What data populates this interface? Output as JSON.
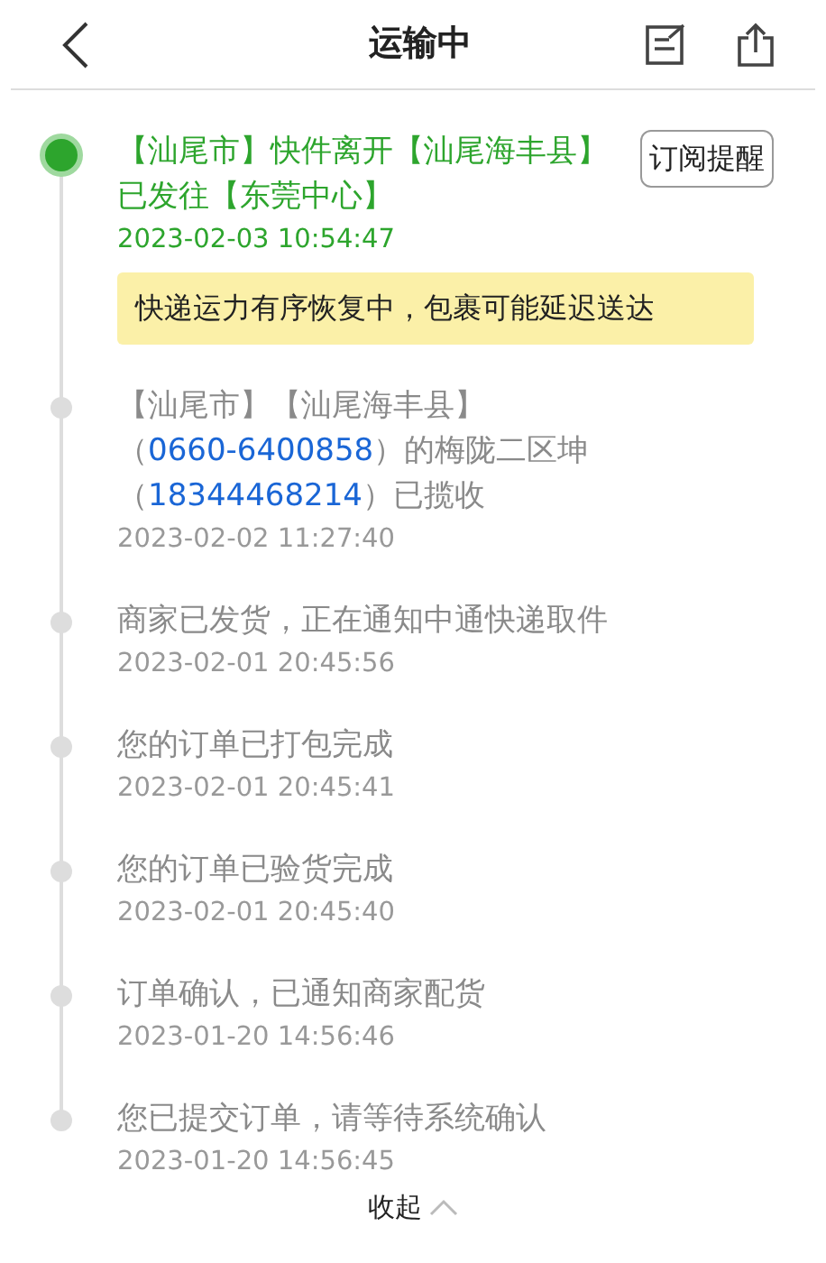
{
  "header": {
    "title": "运输中"
  },
  "subscribe_button": "订阅提醒",
  "notice": "快递运力有序恢复中，包裹可能延迟送达",
  "events": [
    {
      "current": true,
      "parts": [
        {
          "kind": "text",
          "text": "【汕尾市】快件离开【汕尾海丰县】已发往【东莞中心】"
        }
      ],
      "time": "2023-02-03 10:54:47"
    },
    {
      "current": false,
      "parts": [
        {
          "kind": "text",
          "text": "【汕尾市】【汕尾海丰县】（"
        },
        {
          "kind": "phone",
          "text": "0660-6400858"
        },
        {
          "kind": "text",
          "text": "）的梅陇二区坤（"
        },
        {
          "kind": "phone",
          "text": "18344468214"
        },
        {
          "kind": "text",
          "text": "）已揽收"
        }
      ],
      "time": "2023-02-02 11:27:40"
    },
    {
      "current": false,
      "parts": [
        {
          "kind": "text",
          "text": "商家已发货，正在通知中通快递取件"
        }
      ],
      "time": "2023-02-01 20:45:56"
    },
    {
      "current": false,
      "parts": [
        {
          "kind": "text",
          "text": "您的订单已打包完成"
        }
      ],
      "time": "2023-02-01 20:45:41"
    },
    {
      "current": false,
      "parts": [
        {
          "kind": "text",
          "text": "您的订单已验货完成"
        }
      ],
      "time": "2023-02-01 20:45:40"
    },
    {
      "current": false,
      "parts": [
        {
          "kind": "text",
          "text": "订单确认，已通知商家配货"
        }
      ],
      "time": "2023-01-20 14:56:46"
    },
    {
      "current": false,
      "parts": [
        {
          "kind": "text",
          "text": "您已提交订单，请等待系统确认"
        }
      ],
      "time": "2023-01-20 14:56:45"
    }
  ],
  "collapse": {
    "label": "收起",
    "expanded": true
  }
}
